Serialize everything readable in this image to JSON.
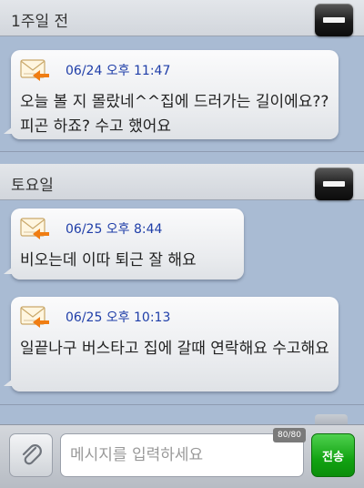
{
  "groups": [
    {
      "title": "1주일 전",
      "messages": [
        {
          "time": "06/24 오후 11:47",
          "body": "오늘 볼 지 몰랐네^^집에 드러가는 길이에요?? 피곤 하죠? 수고 했어요"
        }
      ]
    },
    {
      "title": "토요일",
      "messages": [
        {
          "time": "06/25 오후 8:44",
          "body": "비오는데 이따 퇴근 잘 해요"
        },
        {
          "time": "06/25 오후 10:13",
          "body": "일끝나구 버스타고 집에 갈때 연락해요 수고해요"
        }
      ]
    }
  ],
  "composer": {
    "placeholder": "메시지를 입력하세요",
    "counter": "80/80",
    "send_label": "전송"
  },
  "colors": {
    "background": "#a9bbd3",
    "timestamp": "#1f3ea8",
    "send_button": "#12a312",
    "envelope_arrow": "#f07d12"
  },
  "icons": [
    "minus-icon",
    "envelope-icon",
    "reply-arrow-icon",
    "paperclip-icon"
  ]
}
